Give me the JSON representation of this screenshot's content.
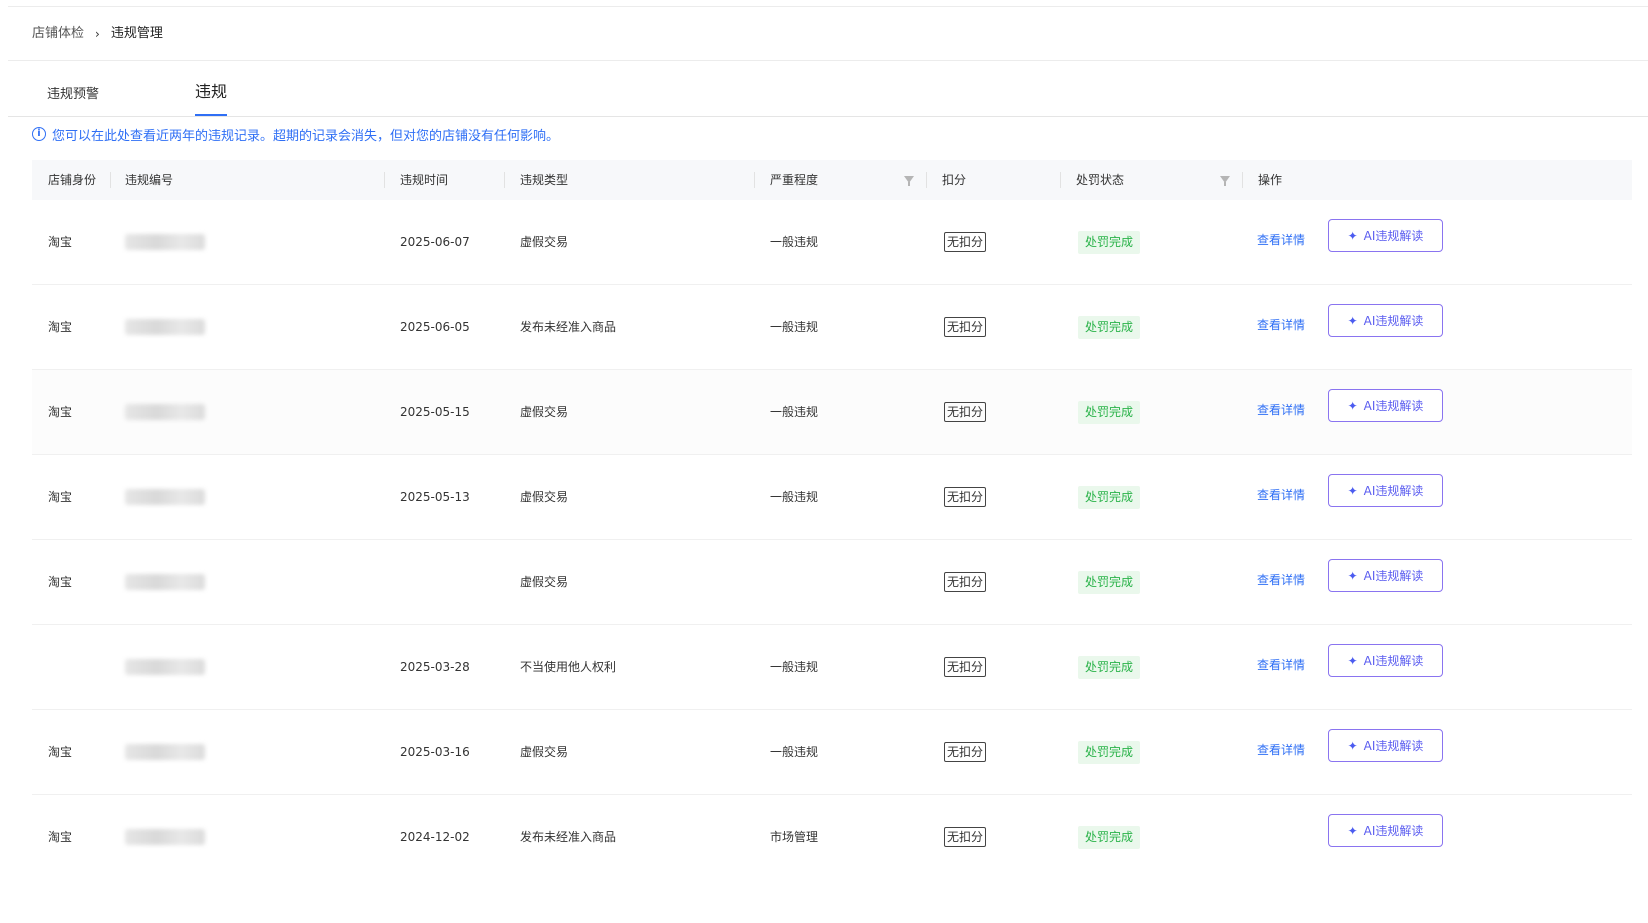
{
  "breadcrumb": {
    "parent": "店铺体检",
    "separator": "›",
    "current": "违规管理"
  },
  "tabs": [
    {
      "label": "违规预警",
      "active": false
    },
    {
      "label": "违规",
      "active": true
    }
  ],
  "notice": {
    "icon": "info-icon",
    "text": "您可以在此处查看近两年的违规记录。超期的记录会消失，但对您的店铺没有任何影响。"
  },
  "table": {
    "headers": {
      "identity": "店铺身份",
      "number": "违规编号",
      "time": "违规时间",
      "type": "违规类型",
      "severity": "严重程度",
      "deduct": "扣分",
      "status": "处罚状态",
      "action": "操作"
    },
    "rows": [
      {
        "identity": "淘宝",
        "time": "2025-06-07",
        "type": "虚假交易",
        "severity": "一般违规",
        "deduct": "无扣分",
        "status": "处罚完成",
        "detail": "查看详情",
        "ai": "AI违规解读"
      },
      {
        "identity": "淘宝",
        "time": "2025-06-05",
        "type": "发布未经准入商品",
        "severity": "一般违规",
        "deduct": "无扣分",
        "status": "处罚完成",
        "detail": "查看详情",
        "ai": "AI违规解读"
      },
      {
        "identity": "淘宝",
        "time": "2025-05-15",
        "type": "虚假交易",
        "severity": "一般违规",
        "deduct": "无扣分",
        "status": "处罚完成",
        "detail": "查看详情",
        "ai": "AI违规解读"
      },
      {
        "identity": "淘宝",
        "time": "2025-05-13",
        "type": "虚假交易",
        "severity": "一般违规",
        "deduct": "无扣分",
        "status": "处罚完成",
        "detail": "查看详情",
        "ai": "AI违规解读"
      },
      {
        "identity": "淘宝",
        "time": "",
        "type": "虚假交易",
        "severity": "",
        "deduct": "无扣分",
        "status": "处罚完成",
        "detail": "查看详情",
        "ai": "AI违规解读"
      },
      {
        "identity": "",
        "time": "2025-03-28",
        "type": "不当使用他人权利",
        "severity": "一般违规",
        "deduct": "无扣分",
        "status": "处罚完成",
        "detail": "查看详情",
        "ai": "AI违规解读"
      },
      {
        "identity": "淘宝",
        "time": "2025-03-16",
        "type": "虚假交易",
        "severity": "一般违规",
        "deduct": "无扣分",
        "status": "处罚完成",
        "detail": "查看详情",
        "ai": "AI违规解读"
      },
      {
        "identity": "淘宝",
        "time": "2024-12-02",
        "type": "发布未经准入商品",
        "severity": "市场管理",
        "deduct": "无扣分",
        "status": "处罚完成",
        "detail": "",
        "ai": "AI违规解读"
      }
    ]
  },
  "icons": {
    "filter": "filter-icon",
    "sparkle": "sparkle-icon",
    "chevron": "chevron-right-icon"
  },
  "colors": {
    "accent": "#2f6ff5",
    "success": "#2bb34a",
    "ai_border": "#8a74f0"
  }
}
